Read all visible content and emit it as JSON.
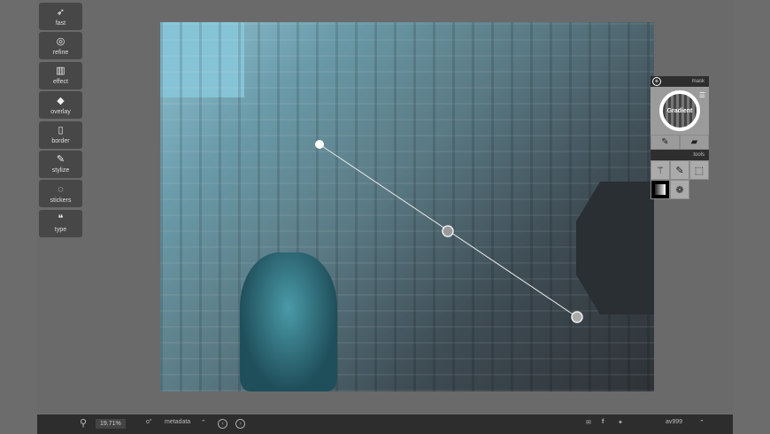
{
  "toolbar": {
    "items": [
      {
        "label": "fast",
        "icon": "rocket-icon",
        "glyph": "🚀"
      },
      {
        "label": "refine",
        "icon": "refine-icon",
        "glyph": "◎"
      },
      {
        "label": "effect",
        "icon": "film-icon",
        "glyph": "▥"
      },
      {
        "label": "overlay",
        "icon": "layers-icon",
        "glyph": "◆"
      },
      {
        "label": "border",
        "icon": "border-icon",
        "glyph": "▯"
      },
      {
        "label": "stylize",
        "icon": "brush-icon",
        "glyph": "✎"
      },
      {
        "label": "stickers",
        "icon": "sticker-icon",
        "glyph": "◌"
      },
      {
        "label": "type",
        "icon": "quote-icon",
        "glyph": "❝"
      }
    ]
  },
  "mask_panel": {
    "header": "mask",
    "add_glyph": "+",
    "thumb_label": "Gradient",
    "tools_header": "tools"
  },
  "bottom": {
    "zoom": "19.71%",
    "metadata": "metadata",
    "user": "av999"
  },
  "colors": {
    "bar": "#2d2d2d",
    "panel": "#9b9b9b"
  }
}
